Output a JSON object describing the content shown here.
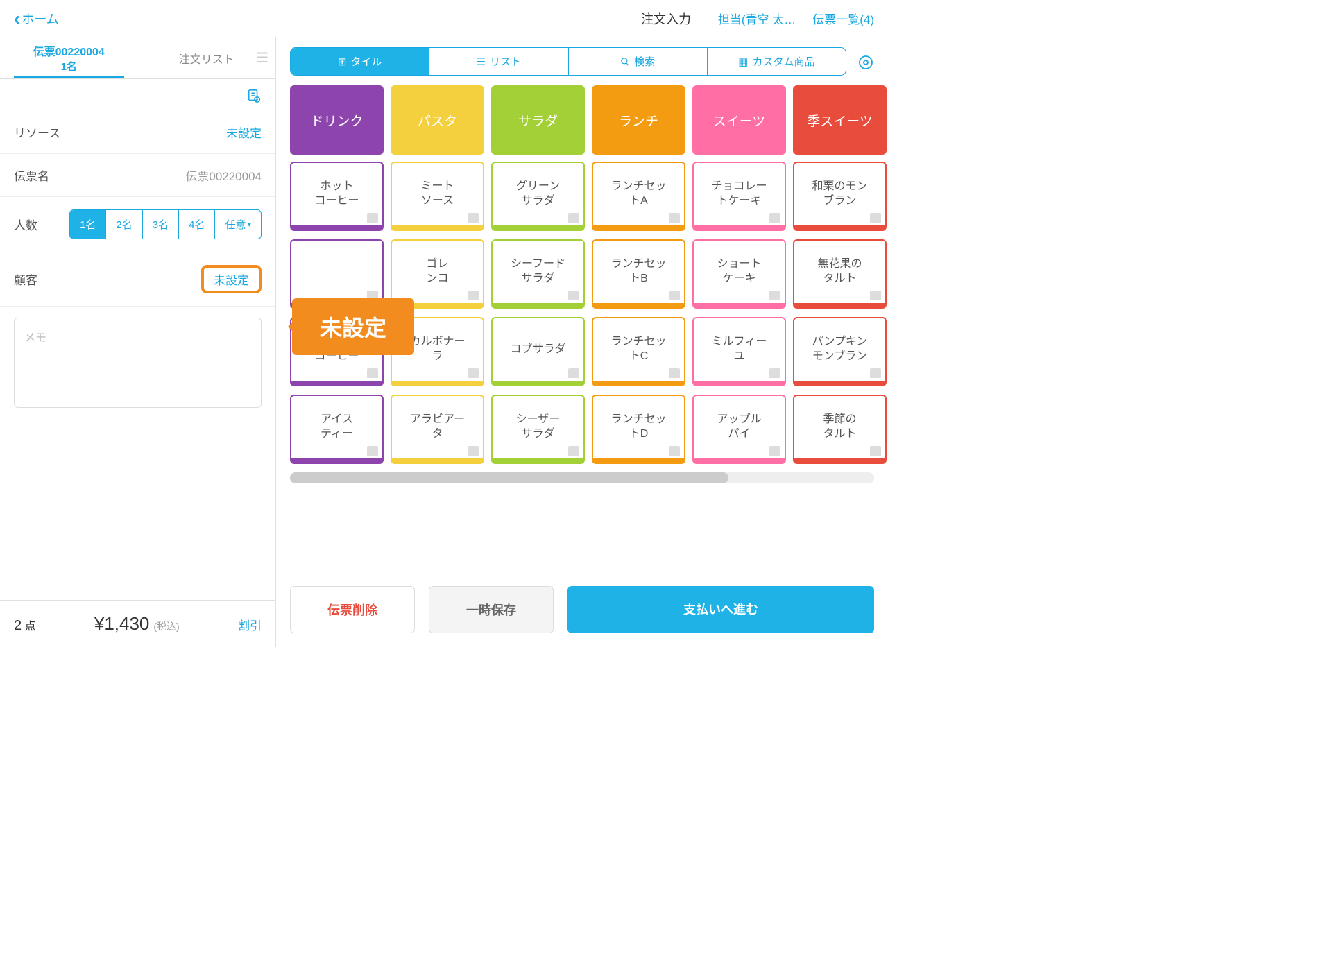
{
  "header": {
    "back": "ホーム",
    "title": "注文入力",
    "staff": "担当(青空 太…",
    "slips": "伝票一覧(4)"
  },
  "tabs": {
    "slip_no": "伝票00220004",
    "people": "1名",
    "order_list": "注文リスト"
  },
  "fields": {
    "resource_label": "リソース",
    "resource_val": "未設定",
    "slip_label": "伝票名",
    "slip_val": "伝票00220004",
    "people_label": "人数",
    "customer_label": "顧客",
    "customer_val": "未設定",
    "memo_placeholder": "メモ"
  },
  "people_opts": [
    "1名",
    "2名",
    "3名",
    "4名",
    "任意"
  ],
  "callout": "未設定",
  "footer_left": {
    "count": "2",
    "count_unit": "点",
    "price": "¥1,430",
    "tax": "(税込)",
    "discount": "割引"
  },
  "view_seg": {
    "tile": "タイル",
    "list": "リスト",
    "search": "検索",
    "custom": "カスタム商品"
  },
  "categories": [
    {
      "label": "ドリンク",
      "color": "#8E44AD"
    },
    {
      "label": "パスタ",
      "color": "#F4D03F"
    },
    {
      "label": "サラダ",
      "color": "#A4D037"
    },
    {
      "label": "ランチ",
      "color": "#F39C12"
    },
    {
      "label": "スイーツ",
      "color": "#FF6FA5"
    },
    {
      "label": "季スイーツ",
      "color": "#E74C3C"
    }
  ],
  "items": [
    [
      {
        "t": "ホット\nコーヒー",
        "c": "#8E44AD"
      },
      {
        "t": "ミート\nソース",
        "c": "#F4D03F"
      },
      {
        "t": "グリーン\nサラダ",
        "c": "#A4D037"
      },
      {
        "t": "ランチセッ\nトA",
        "c": "#F39C12"
      },
      {
        "t": "チョコレー\nトケーキ",
        "c": "#FF6FA5"
      },
      {
        "t": "和栗のモン\nブラン",
        "c": "#E74C3C"
      }
    ],
    [
      {
        "t": "",
        "c": "#8E44AD"
      },
      {
        "t": "ゴレ\nンコ",
        "c": "#F4D03F"
      },
      {
        "t": "シーフード\nサラダ",
        "c": "#A4D037"
      },
      {
        "t": "ランチセッ\nトB",
        "c": "#F39C12"
      },
      {
        "t": "ショート\nケーキ",
        "c": "#FF6FA5"
      },
      {
        "t": "無花果の\nタルト",
        "c": "#E74C3C"
      }
    ],
    [
      {
        "t": "アイス\nコーヒー",
        "c": "#8E44AD"
      },
      {
        "t": "カルボナー\nラ",
        "c": "#F4D03F"
      },
      {
        "t": "コブサラダ",
        "c": "#A4D037"
      },
      {
        "t": "ランチセッ\nトC",
        "c": "#F39C12"
      },
      {
        "t": "ミルフィー\nユ",
        "c": "#FF6FA5"
      },
      {
        "t": "パンプキン\nモンブラン",
        "c": "#E74C3C"
      }
    ],
    [
      {
        "t": "アイス\nティー",
        "c": "#8E44AD"
      },
      {
        "t": "アラビアー\nタ",
        "c": "#F4D03F"
      },
      {
        "t": "シーザー\nサラダ",
        "c": "#A4D037"
      },
      {
        "t": "ランチセッ\nトD",
        "c": "#F39C12"
      },
      {
        "t": "アップル\nパイ",
        "c": "#FF6FA5"
      },
      {
        "t": "季節の\nタルト",
        "c": "#E74C3C"
      }
    ]
  ],
  "footer_right": {
    "delete": "伝票削除",
    "save": "一時保存",
    "pay": "支払いへ進む"
  }
}
